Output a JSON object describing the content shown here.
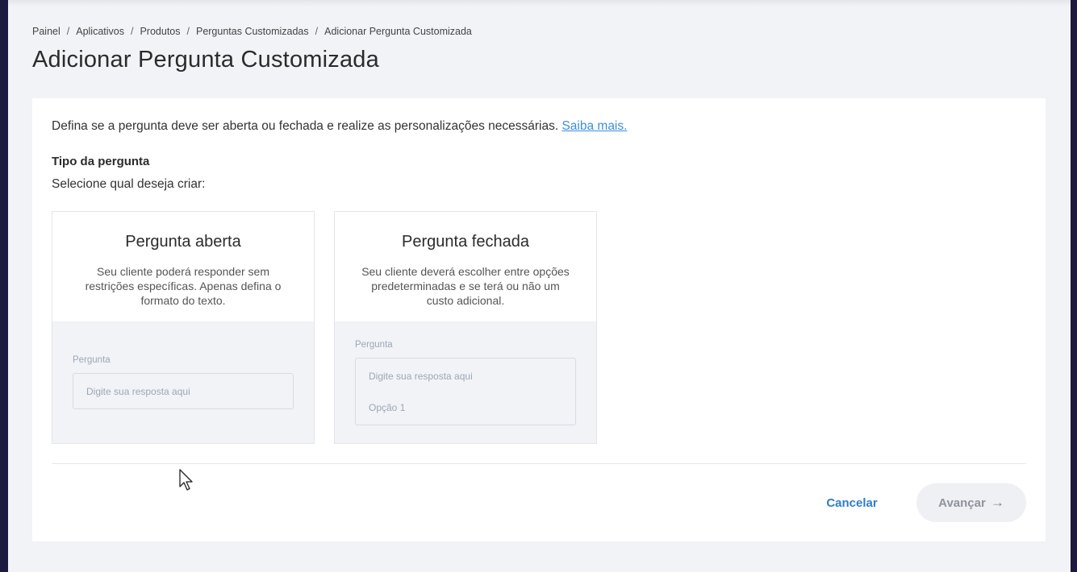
{
  "breadcrumb": {
    "items": [
      "Painel",
      "Aplicativos",
      "Produtos",
      "Perguntas Customizadas",
      "Adicionar Pergunta Customizada"
    ],
    "separator": "/"
  },
  "page": {
    "title": "Adicionar Pergunta Customizada"
  },
  "intro": {
    "text": "Defina se a pergunta deve ser aberta ou fechada e realize as personalizações necessárias. ",
    "link_label": "Saiba mais."
  },
  "question_type": {
    "title": "Tipo da pergunta",
    "subtitle": "Selecione qual deseja criar:"
  },
  "cards": {
    "open": {
      "title": "Pergunta aberta",
      "description": "Seu cliente poderá responder sem restrições específicas. Apenas defina o formato do texto.",
      "preview_label": "Pergunta",
      "preview_placeholder": "Digite sua resposta aqui"
    },
    "closed": {
      "title": "Pergunta fechada",
      "description": "Seu cliente deverá escolher entre opções predeterminadas e se terá ou não um custo adicional.",
      "preview_label": "Pergunta",
      "preview_placeholder": "Digite sua resposta aqui",
      "preview_option": "Opção 1"
    }
  },
  "actions": {
    "cancel_label": "Cancelar",
    "next_label": "Avançar",
    "next_icon": "arrow-right-icon"
  },
  "colors": {
    "accent": "#2d7fc9",
    "link": "#3b8fd8",
    "background": "#f2f3f6",
    "sidebar_edge": "#1c1a3f"
  }
}
